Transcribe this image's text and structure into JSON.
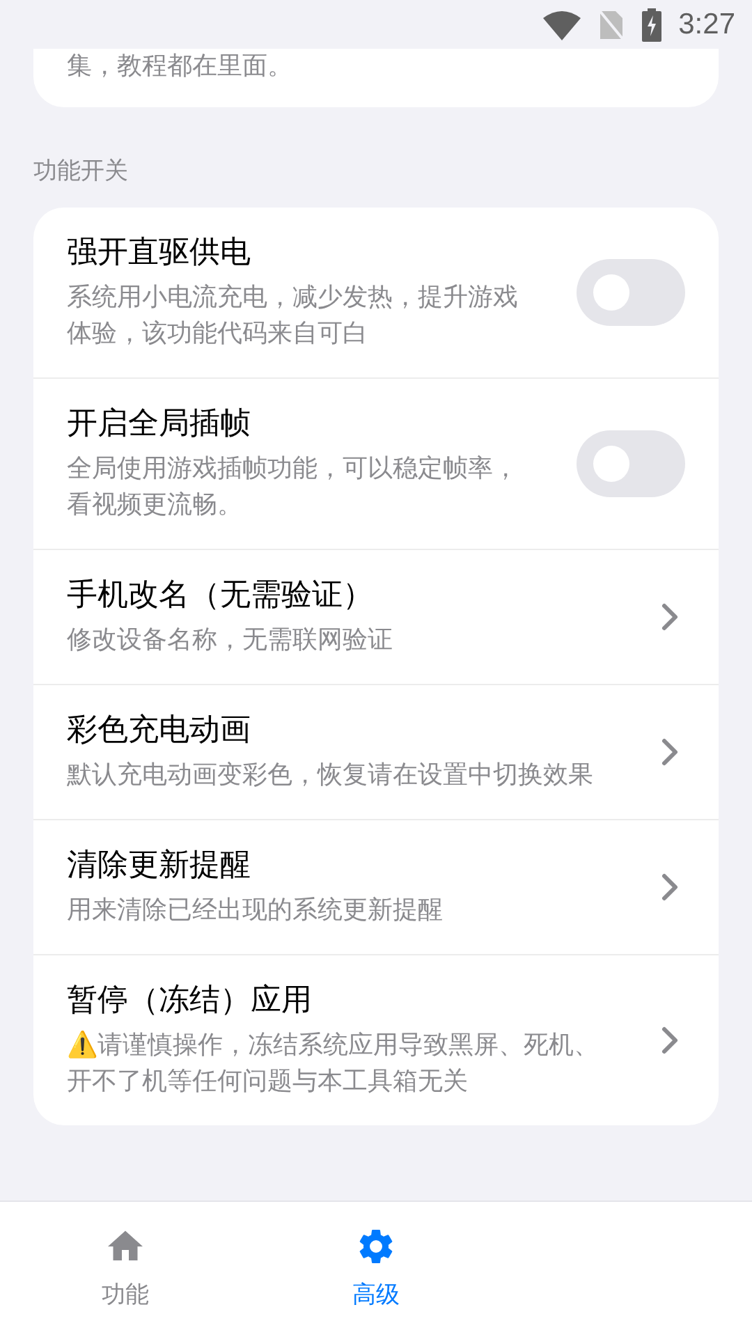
{
  "status_bar": {
    "time": "3:27"
  },
  "intro_card": {
    "text": "集，教程都在里面。"
  },
  "section": {
    "title": "功能开关"
  },
  "items": [
    {
      "kind": "switch",
      "title": "强开直驱供电",
      "description": "系统用小电流充电，减少发热，提升游戏体验，该功能代码来自可白",
      "on": false
    },
    {
      "kind": "switch",
      "title": "开启全局插帧",
      "description": "全局使用游戏插帧功能，可以稳定帧率，看视频更流畅。",
      "on": false
    },
    {
      "kind": "link",
      "title": "手机改名（无需验证）",
      "description": "修改设备名称，无需联网验证"
    },
    {
      "kind": "link",
      "title": "彩色充电动画",
      "description": "默认充电动画变彩色，恢复请在设置中切换效果"
    },
    {
      "kind": "link",
      "title": "清除更新提醒",
      "description": "用来清除已经出现的系统更新提醒"
    },
    {
      "kind": "link",
      "title": "暂停（冻结）应用",
      "description": "⚠️请谨慎操作，冻结系统应用导致黑屏、死机、开不了机等任何问题与本工具箱无关"
    }
  ],
  "nav": [
    {
      "kind": "home",
      "label": "功能",
      "selected": false
    },
    {
      "kind": "gear",
      "label": "高级",
      "selected": true
    }
  ]
}
